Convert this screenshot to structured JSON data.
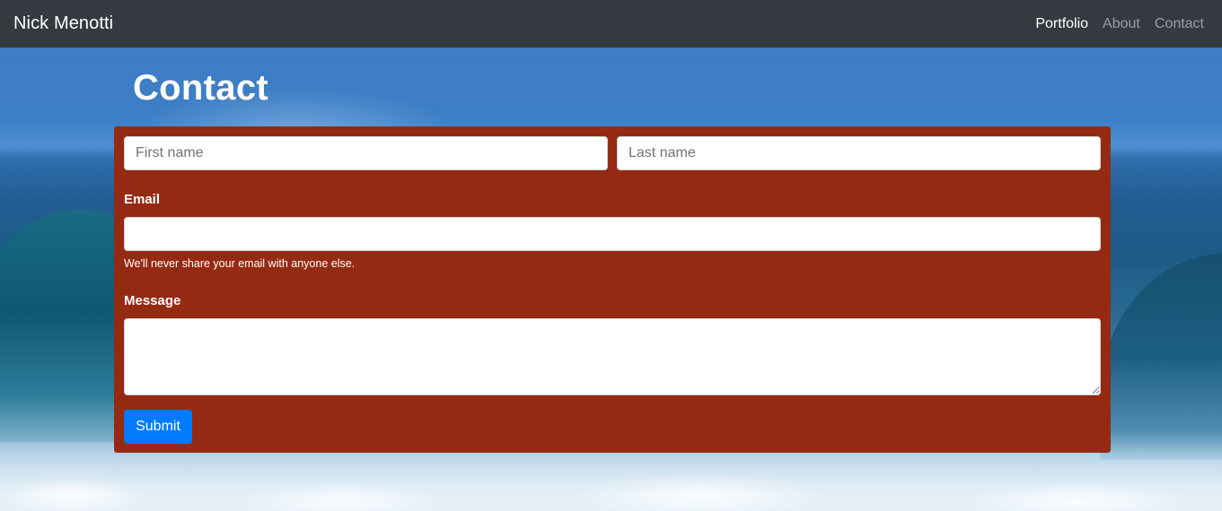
{
  "navbar": {
    "brand": "Nick Menotti",
    "links": [
      {
        "label": "Portfolio",
        "active": true
      },
      {
        "label": "About",
        "active": false
      },
      {
        "label": "Contact",
        "active": false
      }
    ]
  },
  "page": {
    "title": "Contact"
  },
  "form": {
    "first_name": {
      "placeholder": "First name",
      "value": ""
    },
    "last_name": {
      "placeholder": "Last name",
      "value": ""
    },
    "email": {
      "label": "Email",
      "value": "",
      "help": "We'll never share your email with anyone else."
    },
    "message": {
      "label": "Message",
      "value": ""
    },
    "submit_label": "Submit"
  },
  "colors": {
    "navbar_bg": "#343a40",
    "card_bg": "#952a12",
    "button_bg": "#007bff"
  }
}
